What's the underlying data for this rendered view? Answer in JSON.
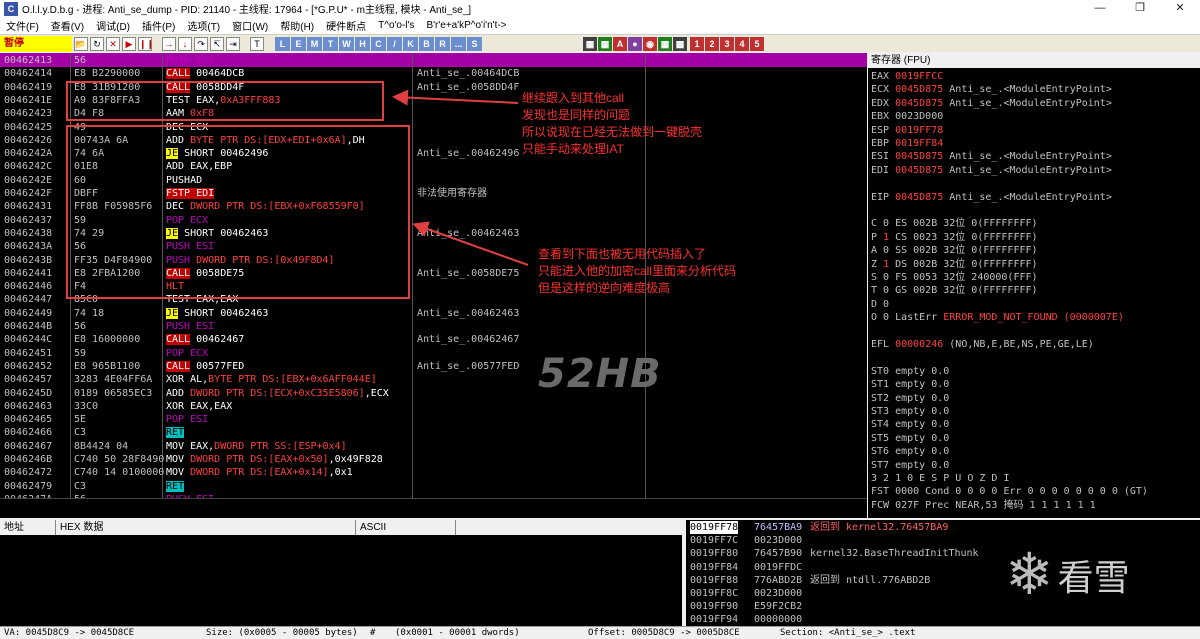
{
  "window": {
    "app_icon": "C",
    "title": "O.l.l.y.D.b.g - 进程: Anti_se_dump - PID: 21140 - 主线程: 17964 - [*G.P.U* - m主线程, 模块 - Anti_se_]"
  },
  "menu": [
    "文件(F)",
    "查看(V)",
    "调试(D)",
    "插件(P)",
    "选项(T)",
    "窗口(W)",
    "帮助(H)",
    "硬件断点",
    "T^o'o-l's",
    "B'r'e+a'kP^o'i'n't->"
  ],
  "toolbar": {
    "status": "暂停",
    "letters": [
      "L",
      "E",
      "M",
      "T",
      "W",
      "H",
      "C",
      "/",
      "K",
      "B",
      "R",
      "...",
      "S"
    ],
    "right_numbers": [
      "1",
      "2",
      "3",
      "4",
      "5"
    ]
  },
  "cpu_rows": [
    {
      "addr": "00462413",
      "hex": "56",
      "dis": [
        {
          "t": "PUSH ESI",
          "c": "push"
        }
      ],
      "cmt": ""
    },
    {
      "addr": "00462414",
      "hex": "E8 B2290000",
      "dis": [
        {
          "t": "CALL",
          "c": "call"
        },
        {
          "t": " 00464DCB"
        }
      ],
      "cmt": "Anti_se_.00464DCB"
    },
    {
      "addr": "00462419",
      "hex": "E8 31B91200",
      "dis": [
        {
          "t": "CALL",
          "c": "call"
        },
        {
          "t": " 0058DD4F"
        }
      ],
      "cmt": "Anti_se_.0058DD4F"
    },
    {
      "addr": "0046241E",
      "hex": "A9 83F8FFA3",
      "dis": [
        {
          "t": "TEST EAX,"
        },
        {
          "t": "0xA3FFF883",
          "c": "red"
        }
      ],
      "cmt": ""
    },
    {
      "addr": "00462423",
      "hex": "D4 F8",
      "dis": [
        {
          "t": "AAM "
        },
        {
          "t": "0xF8",
          "c": "red"
        }
      ],
      "cmt": ""
    },
    {
      "addr": "00462425",
      "hex": "49",
      "dis": [
        {
          "t": "DEC ECX"
        }
      ],
      "cmt": ""
    },
    {
      "addr": "00462426",
      "hex": "00743A 6A",
      "dis": [
        {
          "t": "ADD "
        },
        {
          "t": "BYTE PTR DS:[EDX+EDI+0x6A]",
          "c": "red"
        },
        {
          "t": ",DH"
        }
      ],
      "cmt": ""
    },
    {
      "addr": "0046242A",
      "hex": "74 6A",
      "dis": [
        {
          "t": "JE",
          "c": "jmp"
        },
        {
          "t": " SHORT 00462496"
        }
      ],
      "cmt": "Anti_se_.00462496"
    },
    {
      "addr": "0046242C",
      "hex": "01E8",
      "dis": [
        {
          "t": "ADD EAX,EBP"
        }
      ],
      "cmt": ""
    },
    {
      "addr": "0046242E",
      "hex": "60",
      "dis": [
        {
          "t": "PUSHAD"
        }
      ],
      "cmt": ""
    },
    {
      "addr": "0046242F",
      "hex": "DBFF",
      "dis": [
        {
          "t": "FSTP EDI",
          "c": "call"
        }
      ],
      "cmt": "非法使用寄存器"
    },
    {
      "addr": "00462431",
      "hex": "FF8B F05985F6",
      "dis": [
        {
          "t": "DEC "
        },
        {
          "t": "DWORD PTR DS:[EBX+0xF68559F0]",
          "c": "red"
        }
      ],
      "cmt": ""
    },
    {
      "addr": "00462437",
      "hex": "59",
      "dis": [
        {
          "t": "POP ECX",
          "c": "push"
        }
      ],
      "cmt": ""
    },
    {
      "addr": "00462438",
      "hex": "74 29",
      "dis": [
        {
          "t": "JE",
          "c": "jmp"
        },
        {
          "t": " SHORT 00462463"
        }
      ],
      "cmt": "Anti_se_.00462463"
    },
    {
      "addr": "0046243A",
      "hex": "56",
      "dis": [
        {
          "t": "PUSH ESI",
          "c": "push"
        }
      ],
      "cmt": ""
    },
    {
      "addr": "0046243B",
      "hex": "FF35 D4F84900",
      "dis": [
        {
          "t": "PUSH ",
          "c": "push"
        },
        {
          "t": "DWORD PTR DS:[0x49F8D4]",
          "c": "red"
        }
      ],
      "cmt": ""
    },
    {
      "addr": "00462441",
      "hex": "E8 2FBA1200",
      "dis": [
        {
          "t": "CALL",
          "c": "call"
        },
        {
          "t": " 0058DE75"
        }
      ],
      "cmt": "Anti_se_.0058DE75"
    },
    {
      "addr": "00462446",
      "hex": "F4",
      "dis": [
        {
          "t": "HLT",
          "c": "red"
        }
      ],
      "cmt": ""
    },
    {
      "addr": "00462447",
      "hex": "85C0",
      "dis": [
        {
          "t": "TEST EAX,EAX"
        }
      ],
      "cmt": ""
    },
    {
      "addr": "00462449",
      "hex": "74 18",
      "dis": [
        {
          "t": "JE",
          "c": "jmp"
        },
        {
          "t": " SHORT 00462463"
        }
      ],
      "cmt": "Anti_se_.00462463"
    },
    {
      "addr": "0046244B",
      "hex": "56",
      "dis": [
        {
          "t": "PUSH ESI",
          "c": "push"
        }
      ],
      "cmt": ""
    },
    {
      "addr": "0046244C",
      "hex": "E8 16000000",
      "dis": [
        {
          "t": "CALL",
          "c": "call"
        },
        {
          "t": " 00462467"
        }
      ],
      "cmt": "Anti_se_.00462467"
    },
    {
      "addr": "00462451",
      "hex": "59",
      "dis": [
        {
          "t": "POP ECX",
          "c": "push"
        }
      ],
      "cmt": ""
    },
    {
      "addr": "00462452",
      "hex": "E8 965B1100",
      "dis": [
        {
          "t": "CALL",
          "c": "call"
        },
        {
          "t": " 00577FED"
        }
      ],
      "cmt": "Anti_se_.00577FED"
    },
    {
      "addr": "00462457",
      "hex": "3283 4E04FF6A",
      "dis": [
        {
          "t": "XOR AL,"
        },
        {
          "t": "BYTE PTR DS:[EBX+0x6AFF044E]",
          "c": "red"
        }
      ],
      "cmt": ""
    },
    {
      "addr": "0046245D",
      "hex": "0189 06585EC3",
      "dis": [
        {
          "t": "ADD "
        },
        {
          "t": "DWORD PTR DS:[ECX+0xC35E5806]",
          "c": "red"
        },
        {
          "t": ",ECX"
        }
      ],
      "cmt": ""
    },
    {
      "addr": "00462463",
      "hex": "33C0",
      "dis": [
        {
          "t": "XOR EAX,EAX"
        }
      ],
      "cmt": ""
    },
    {
      "addr": "00462465",
      "hex": "5E",
      "dis": [
        {
          "t": "POP ESI",
          "c": "push"
        }
      ],
      "cmt": ""
    },
    {
      "addr": "00462466",
      "hex": "C3",
      "dis": [
        {
          "t": "RET",
          "c": "ret"
        }
      ],
      "cmt": ""
    },
    {
      "addr": "00462467",
      "hex": "8B4424 04",
      "dis": [
        {
          "t": "MOV EAX,"
        },
        {
          "t": "DWORD PTR SS:[ESP+0x4]",
          "c": "red"
        }
      ],
      "cmt": ""
    },
    {
      "addr": "0046246B",
      "hex": "C740 50 28F8490",
      "dis": [
        {
          "t": "MOV "
        },
        {
          "t": "DWORD PTR DS:[EAX+0x50]",
          "c": "red"
        },
        {
          "t": ",0x49F828"
        }
      ],
      "cmt": ""
    },
    {
      "addr": "00462472",
      "hex": "C740 14 0100000",
      "dis": [
        {
          "t": "MOV "
        },
        {
          "t": "DWORD PTR DS:[EAX+0x14]",
          "c": "red"
        },
        {
          "t": ",0x1"
        }
      ],
      "cmt": ""
    },
    {
      "addr": "00462479",
      "hex": "C3",
      "dis": [
        {
          "t": "RET",
          "c": "ret"
        }
      ],
      "cmt": ""
    },
    {
      "addr": "0046247A",
      "hex": "56",
      "dis": [
        {
          "t": "PUSH ESI",
          "c": "push"
        }
      ],
      "cmt": ""
    }
  ],
  "annotations": {
    "note1": [
      "继续跟入到其他call",
      "发现也是同样的问题",
      "所以说现在已经无法做到一键脱壳",
      "只能手动来处理IAT"
    ],
    "note2": [
      "查看到下面也被无用代码插入了",
      "只能进入他的加密call里面来分析代码",
      "但是这样的逆向难度极高"
    ],
    "watermark": "52HB"
  },
  "registers": {
    "title": "寄存器 (FPU)",
    "lines": [
      [
        {
          "t": "EAX "
        },
        {
          "t": "0019FFCC",
          "c": "red"
        }
      ],
      [
        {
          "t": "ECX "
        },
        {
          "t": "0045D875",
          "c": "red"
        },
        {
          "t": " Anti_se_.<ModuleEntryPoint>"
        }
      ],
      [
        {
          "t": "EDX "
        },
        {
          "t": "0045D875",
          "c": "red"
        },
        {
          "t": " Anti_se_.<ModuleEntryPoint>"
        }
      ],
      [
        {
          "t": "EBX 0023D000"
        }
      ],
      [
        {
          "t": "ESP "
        },
        {
          "t": "0019FF78",
          "c": "red"
        }
      ],
      [
        {
          "t": "EBP "
        },
        {
          "t": "0019FF84",
          "c": "red"
        }
      ],
      [
        {
          "t": "ESI "
        },
        {
          "t": "0045D875",
          "c": "red"
        },
        {
          "t": " Anti_se_.<ModuleEntryPoint>"
        }
      ],
      [
        {
          "t": "EDI "
        },
        {
          "t": "0045D875",
          "c": "red"
        },
        {
          "t": " Anti_se_.<ModuleEntryPoint>"
        }
      ],
      [
        {
          "t": ""
        }
      ],
      [
        {
          "t": "EIP "
        },
        {
          "t": "0045D875",
          "c": "red"
        },
        {
          "t": " Anti_se_.<ModuleEntryPoint>"
        }
      ],
      [
        {
          "t": ""
        }
      ],
      [
        {
          "t": "C 0  ES 002B 32位 0(FFFFFFFF)"
        }
      ],
      [
        {
          "t": "P "
        },
        {
          "t": "1",
          "c": "red"
        },
        {
          "t": "  CS 0023 32位 0(FFFFFFFF)"
        }
      ],
      [
        {
          "t": "A 0  SS 002B 32位 0(FFFFFFFF)"
        }
      ],
      [
        {
          "t": "Z "
        },
        {
          "t": "1",
          "c": "red"
        },
        {
          "t": "  DS 002B 32位 0(FFFFFFFF)"
        }
      ],
      [
        {
          "t": "S 0  FS 0053 32位 240000(FFF)"
        }
      ],
      [
        {
          "t": "T 0  GS 002B 32位 0(FFFFFFFF)"
        }
      ],
      [
        {
          "t": "D 0"
        }
      ],
      [
        {
          "t": "O 0  LastErr "
        },
        {
          "t": "ERROR_MOD_NOT_FOUND (0000007E)",
          "c": "red"
        }
      ],
      [
        {
          "t": ""
        }
      ],
      [
        {
          "t": "EFL "
        },
        {
          "t": "00000246",
          "c": "red"
        },
        {
          "t": " (NO,NB,E,BE,NS,PE,GE,LE)"
        }
      ],
      [
        {
          "t": ""
        }
      ],
      [
        {
          "t": "ST0 empty 0.0"
        }
      ],
      [
        {
          "t": "ST1 empty 0.0"
        }
      ],
      [
        {
          "t": "ST2 empty 0.0"
        }
      ],
      [
        {
          "t": "ST3 empty 0.0"
        }
      ],
      [
        {
          "t": "ST4 empty 0.0"
        }
      ],
      [
        {
          "t": "ST5 empty 0.0"
        }
      ],
      [
        {
          "t": "ST6 empty 0.0"
        }
      ],
      [
        {
          "t": "ST7 empty 0.0"
        }
      ],
      [
        {
          "t": "               3 2 1 0      E S P U O Z D I"
        }
      ],
      [
        {
          "t": "FST 0000  Cond 0 0 0 0  Err 0 0 0 0 0 0 0 0  (GT)"
        }
      ],
      [
        {
          "t": "FCW 027F  Prec NEAR,53  掩码    1 1 1 1 1 1"
        }
      ]
    ]
  },
  "dump": {
    "col_addr": "地址",
    "col_hex": "HEX 数据",
    "col_ascii": "ASCII"
  },
  "stack_rows": [
    {
      "addr": "0019FF78",
      "val": "76457BA9",
      "cmt": "返回到 kernel32.76457BA9",
      "sel": true
    },
    {
      "addr": "0019FF7C",
      "val": "0023D000",
      "cmt": ""
    },
    {
      "addr": "0019FF80",
      "val": "76457B90",
      "cmt": "kernel32.BaseThreadInitThunk"
    },
    {
      "addr": "0019FF84",
      "val": "0019FFDC",
      "cmt": ""
    },
    {
      "addr": "0019FF88",
      "val": "776ABD2B",
      "cmt": "返回到 ntdll.776ABD2B"
    },
    {
      "addr": "0019FF8C",
      "val": "0023D000",
      "cmt": ""
    },
    {
      "addr": "0019FF90",
      "val": "E59F2CB2",
      "cmt": ""
    },
    {
      "addr": "0019FF94",
      "val": "00000000",
      "cmt": ""
    }
  ],
  "statusbar": [
    "VA: 0045D8C9 -> 0045D8CE",
    "Size: (0x0005 - 00005 bytes)",
    "#",
    "(0x0001 - 00001 dwords)",
    "Offset: 0005D8C9 -> 0005D8CE",
    "Section: <Anti_se_> .text"
  ],
  "logo": {
    "text": "看雪"
  }
}
